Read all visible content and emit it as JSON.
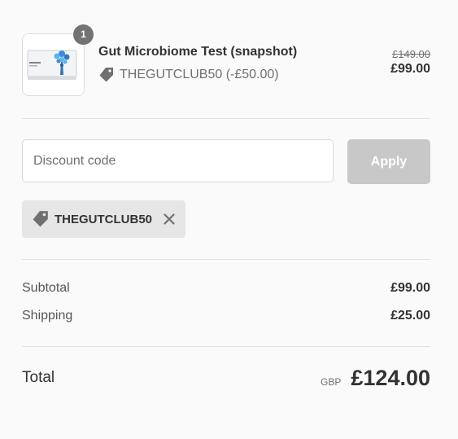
{
  "product": {
    "quantity": "1",
    "name": "Gut Microbiome Test (snapshot)",
    "discount_line": "THEGUTCLUB50 (-£50.00)",
    "original_price": "£149.00",
    "price": "£99.00",
    "tag_icon": "tag-icon"
  },
  "discount": {
    "placeholder": "Discount code",
    "value": "",
    "apply_label": "Apply",
    "applied_code": "THEGUTCLUB50",
    "remove_icon": "close-icon"
  },
  "summary": {
    "subtotal_label": "Subtotal",
    "subtotal_value": "£99.00",
    "shipping_label": "Shipping",
    "shipping_value": "£25.00",
    "total_label": "Total",
    "currency": "GBP",
    "total_value": "£124.00"
  },
  "colors": {
    "background": "#fafafa",
    "badge": "#737373",
    "apply_button": "#c8c8c8",
    "chip": "#e6e6e6",
    "text": "#333333",
    "muted": "#707070"
  }
}
